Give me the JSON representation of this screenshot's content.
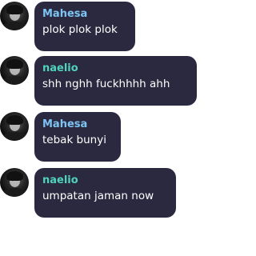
{
  "colors": {
    "bubble_bg": "#2b2940",
    "sender_mahesa": "#7ec4f2",
    "sender_naelio": "#4fd3bd",
    "message_text": "#ffffff"
  },
  "messages": [
    {
      "sender": "Mahesa",
      "text": "plok plok plok",
      "avatar": "avatar-mahesa"
    },
    {
      "sender": "naelio",
      "text": "shh nghh fuckhhhh ahh",
      "avatar": "avatar-naelio"
    },
    {
      "sender": "Mahesa",
      "text": "tebak bunyi",
      "avatar": "avatar-mahesa"
    },
    {
      "sender": "naelio",
      "text": "umpatan jaman now",
      "avatar": "avatar-naelio"
    }
  ]
}
